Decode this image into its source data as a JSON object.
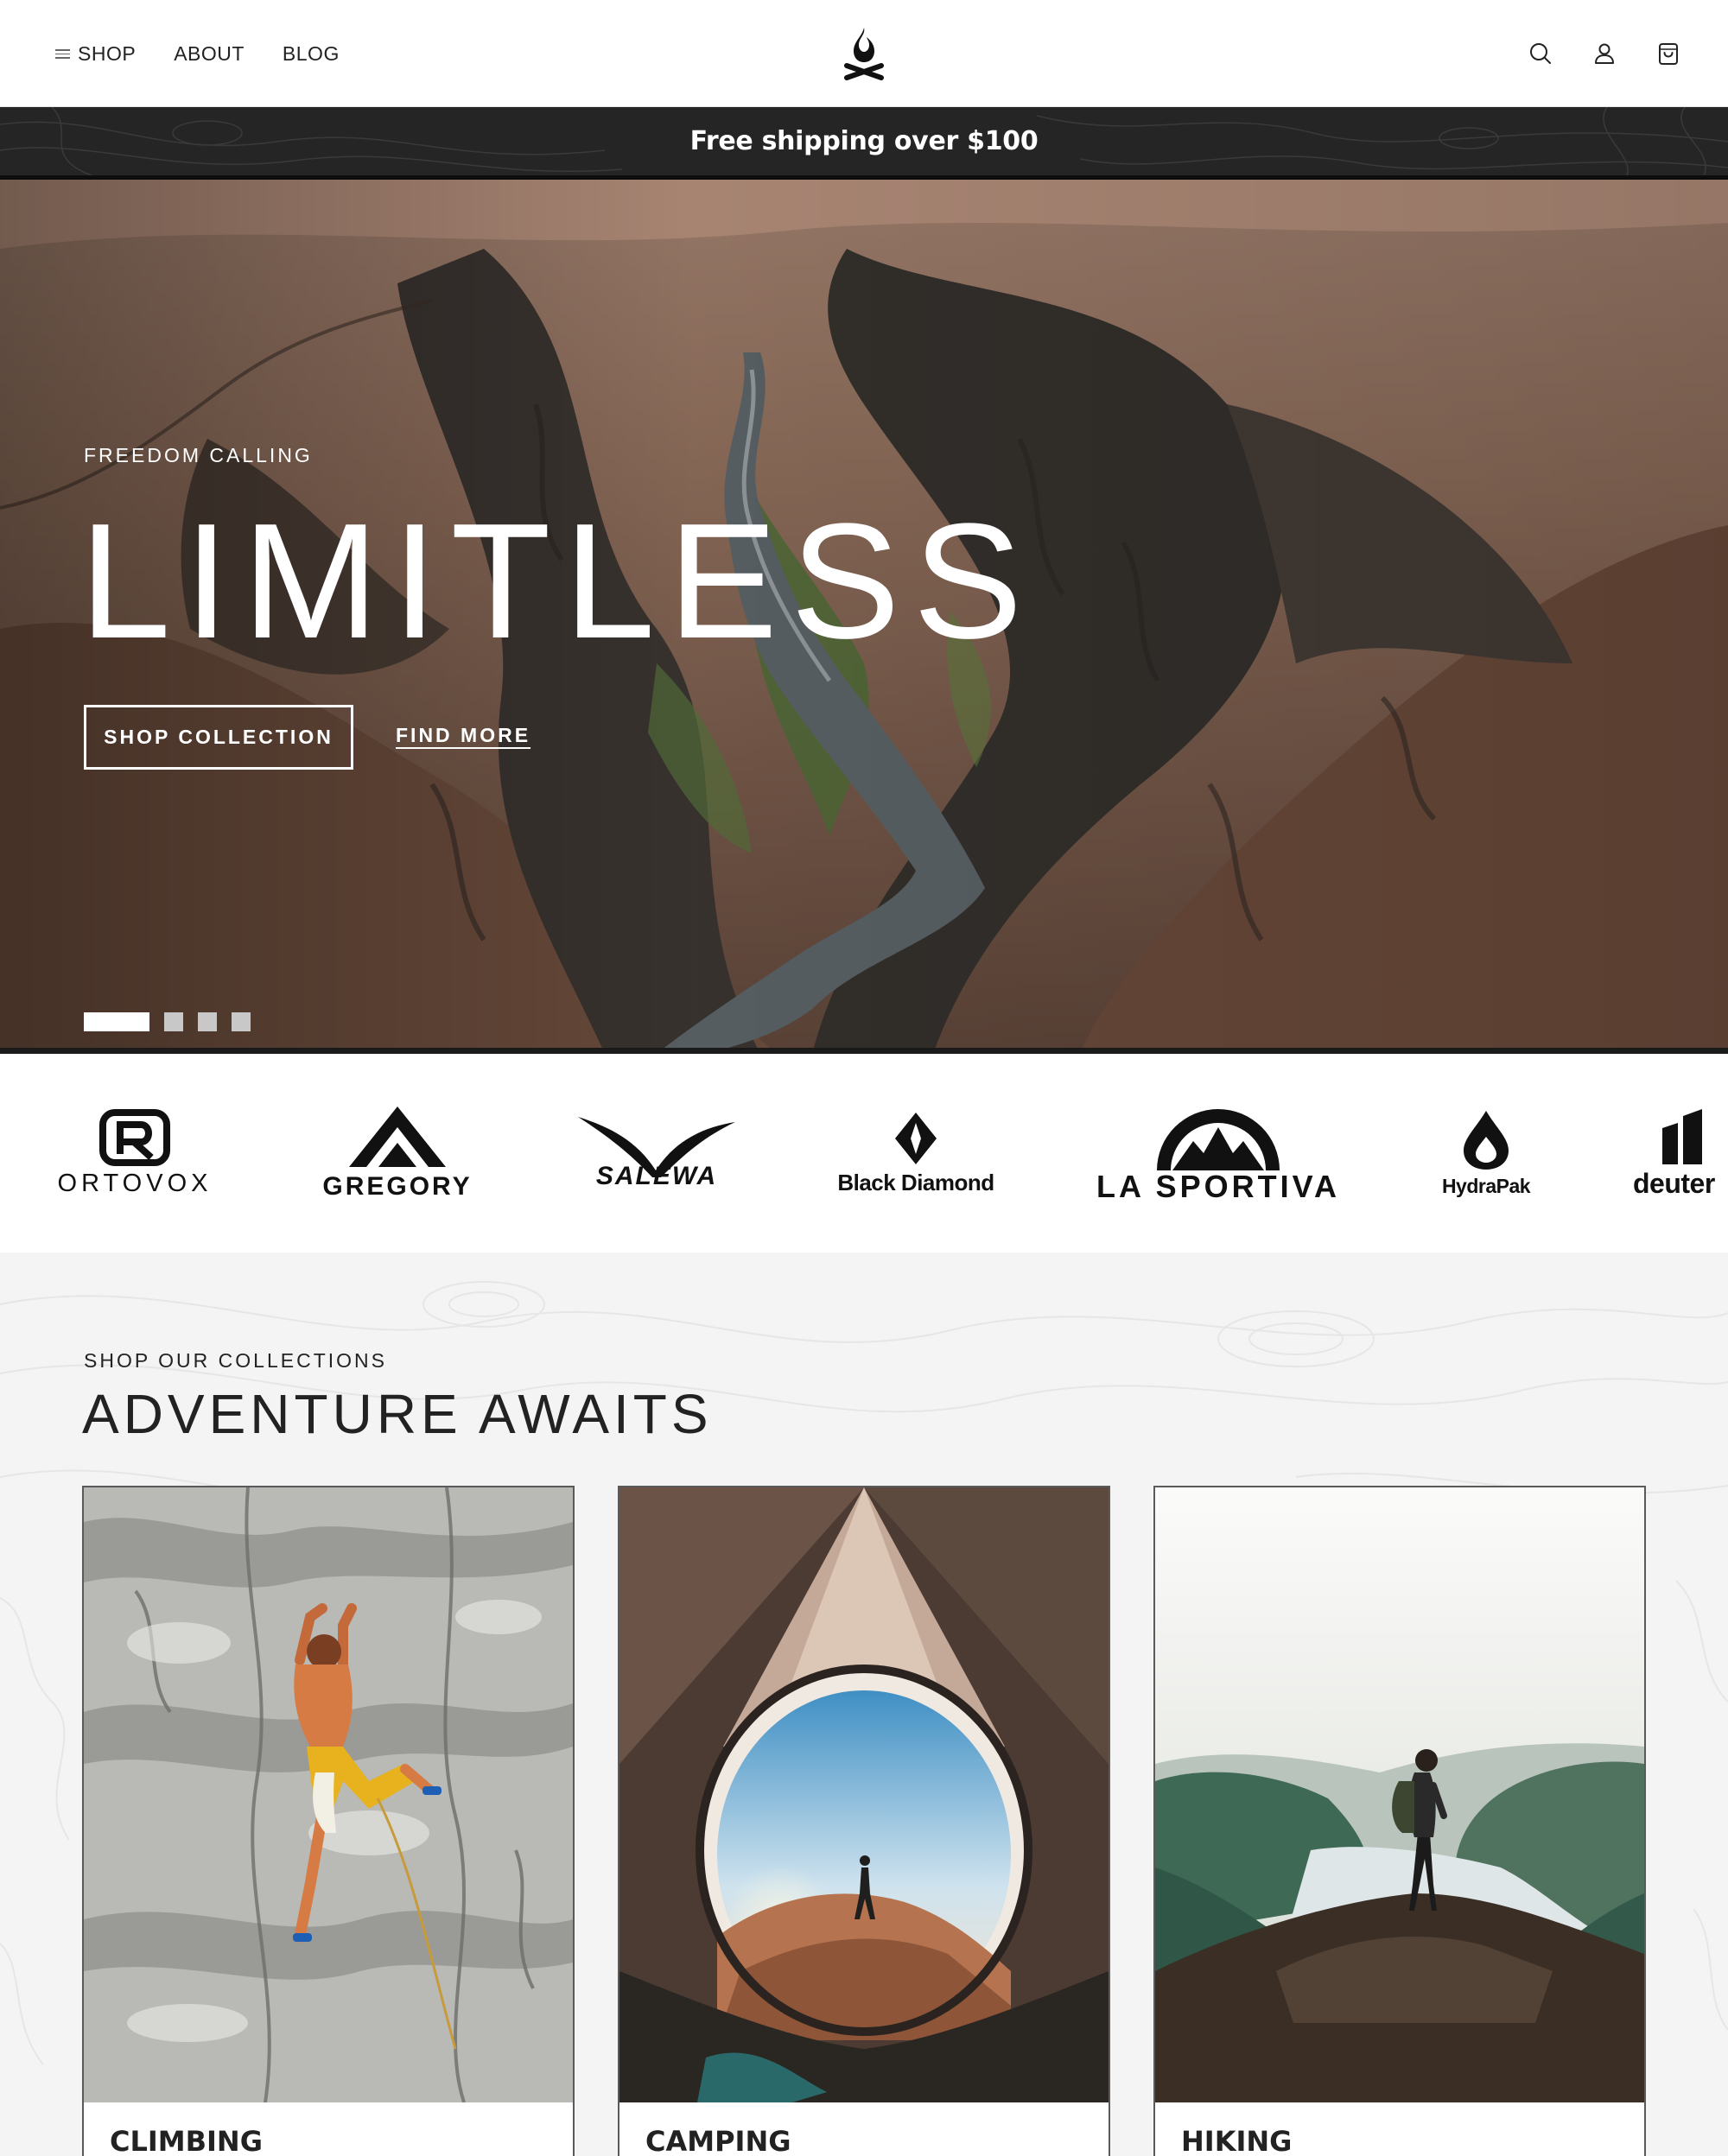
{
  "header": {
    "nav": [
      {
        "label": "SHOP",
        "icon": "hamburger-icon"
      },
      {
        "label": "ABOUT"
      },
      {
        "label": "BLOG"
      }
    ],
    "logo_icon": "campfire-icon",
    "icons": [
      "search-icon",
      "account-icon",
      "cart-icon"
    ]
  },
  "announcement": {
    "text": "Free shipping over $100"
  },
  "hero": {
    "eyebrow": "FREEDOM CALLING",
    "title": "LIMITLESS",
    "primary_button": "SHOP COLLECTION",
    "secondary_link": "FIND MORE",
    "slides_total": 4,
    "active_slide": 1
  },
  "brands": [
    {
      "name": "ORTOVOX"
    },
    {
      "name": "GREGORY"
    },
    {
      "name": "SALEWA"
    },
    {
      "name": "Black Diamond"
    },
    {
      "name": "LA SPORTIVA"
    },
    {
      "name": "HydraPak"
    },
    {
      "name": "deuter"
    }
  ],
  "collections": {
    "eyebrow": "SHOP OUR COLLECTIONS",
    "title": "ADVENTURE AWAITS",
    "cards": [
      {
        "label": "CLIMBING"
      },
      {
        "label": "CAMPING"
      },
      {
        "label": "HIKING"
      }
    ]
  },
  "colors": {
    "announcement_bg": "#252525",
    "section_bg": "#f4f4f4",
    "text": "#1c1c1c"
  }
}
